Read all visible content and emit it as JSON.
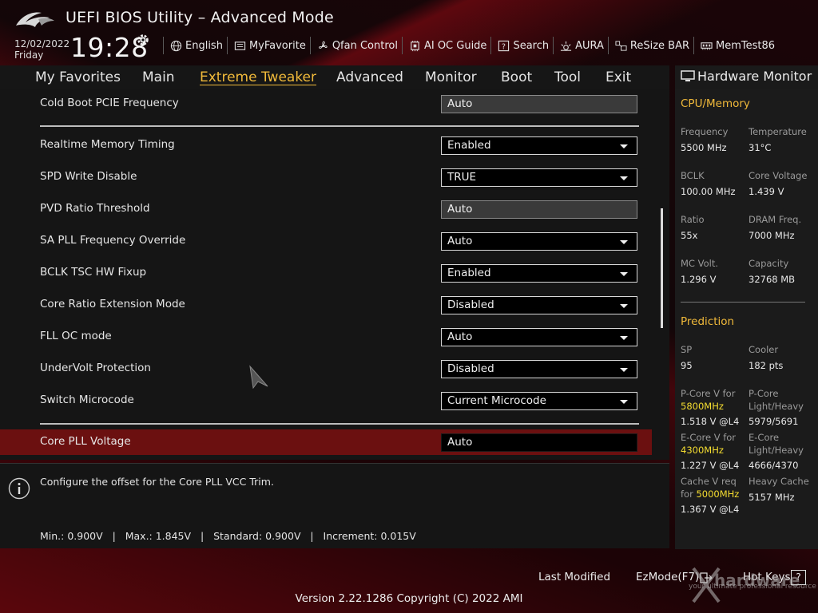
{
  "header": {
    "title": "UEFI BIOS Utility – Advanced Mode",
    "date": "12/02/2022",
    "day": "Friday",
    "time": "19:28",
    "tools": [
      {
        "label": "English",
        "icon": "globe-icon"
      },
      {
        "label": "MyFavorite",
        "icon": "favorite-icon"
      },
      {
        "label": "Qfan Control",
        "icon": "fan-icon"
      },
      {
        "label": "AI OC Guide",
        "icon": "ai-chip-icon"
      },
      {
        "label": "Search",
        "icon": "search-help-icon"
      },
      {
        "label": "AURA",
        "icon": "aura-light-icon"
      },
      {
        "label": "ReSize BAR",
        "icon": "resize-bar-icon"
      },
      {
        "label": "MemTest86",
        "icon": "memory-icon"
      }
    ]
  },
  "nav": {
    "tabs": [
      "My Favorites",
      "Main",
      "Extreme Tweaker",
      "Advanced",
      "Monitor",
      "Boot",
      "Tool",
      "Exit"
    ],
    "active": "Extreme Tweaker"
  },
  "settings": [
    {
      "label": "Cold Boot PCIE Frequency",
      "value": "Auto",
      "type": "static"
    },
    {
      "label": "Realtime Memory Timing",
      "value": "Enabled",
      "type": "dropdown"
    },
    {
      "label": "SPD Write Disable",
      "value": "TRUE",
      "type": "dropdown"
    },
    {
      "label": "PVD Ratio Threshold",
      "value": "Auto",
      "type": "static"
    },
    {
      "label": "SA PLL Frequency Override",
      "value": "Auto",
      "type": "dropdown"
    },
    {
      "label": "BCLK TSC HW Fixup",
      "value": "Enabled",
      "type": "dropdown"
    },
    {
      "label": "Core Ratio Extension Mode",
      "value": "Disabled",
      "type": "dropdown"
    },
    {
      "label": "FLL OC mode",
      "value": "Auto",
      "type": "dropdown"
    },
    {
      "label": "UnderVolt Protection",
      "value": "Disabled",
      "type": "dropdown"
    },
    {
      "label": "Switch Microcode",
      "value": "Current Microcode",
      "type": "dropdown"
    },
    {
      "label": "Core PLL Voltage",
      "value": "Auto",
      "type": "input",
      "selected": true
    }
  ],
  "help": {
    "text": "Configure the offset for the Core PLL VCC Trim.",
    "limits": "Min.: 0.900V   |   Max.: 1.845V   |   Standard: 0.900V   |   Increment: 0.015V"
  },
  "hardware_monitor": {
    "title": "Hardware Monitor",
    "cpu_memory": {
      "title": "CPU/Memory",
      "items": [
        {
          "label": "Frequency",
          "value": "5500 MHz"
        },
        {
          "label": "Temperature",
          "value": "31°C"
        },
        {
          "label": "BCLK",
          "value": "100.00 MHz"
        },
        {
          "label": "Core Voltage",
          "value": "1.439 V"
        },
        {
          "label": "Ratio",
          "value": "55x"
        },
        {
          "label": "DRAM Freq.",
          "value": "7000 MHz"
        },
        {
          "label": "MC Volt.",
          "value": "1.296 V"
        },
        {
          "label": "Capacity",
          "value": "32768 MB"
        }
      ]
    },
    "prediction": {
      "title": "Prediction",
      "sp_label": "SP",
      "sp_value": "95",
      "cooler_label": "Cooler",
      "cooler_value": "182 pts",
      "pcore_label": "P-Core V for",
      "pcore_freq": "5800MHz",
      "pcore_value": "1.518 V @L4",
      "pcore_lh_label1": "P-Core",
      "pcore_lh_label2": "Light/Heavy",
      "pcore_lh_value": "5979/5691",
      "ecore_label": "E-Core V for",
      "ecore_freq": "4300MHz",
      "ecore_value": "1.227 V @L4",
      "ecore_lh_label1": "E-Core",
      "ecore_lh_label2": "Light/Heavy",
      "ecore_lh_value": "4666/4370",
      "cache_label1": "Cache V req",
      "cache_label2": "for",
      "cache_freq": "5000MHz",
      "cache_value": "1.367 V @L4",
      "heavy_cache_label": "Heavy Cache",
      "heavy_cache_value": "5157 MHz"
    }
  },
  "footer": {
    "last_modified": "Last Modified",
    "ez_mode": "EzMode(F7)",
    "hot_keys": "Hot Keys",
    "help_key": "?",
    "version": "Version 2.22.1286 Copyright (C) 2022 AMI",
    "watermark": "your ultimate professional resource"
  },
  "colors": {
    "accent": "#f0b93a",
    "highlight_value": "#f5dd30",
    "selected_row": "#6b1010"
  }
}
